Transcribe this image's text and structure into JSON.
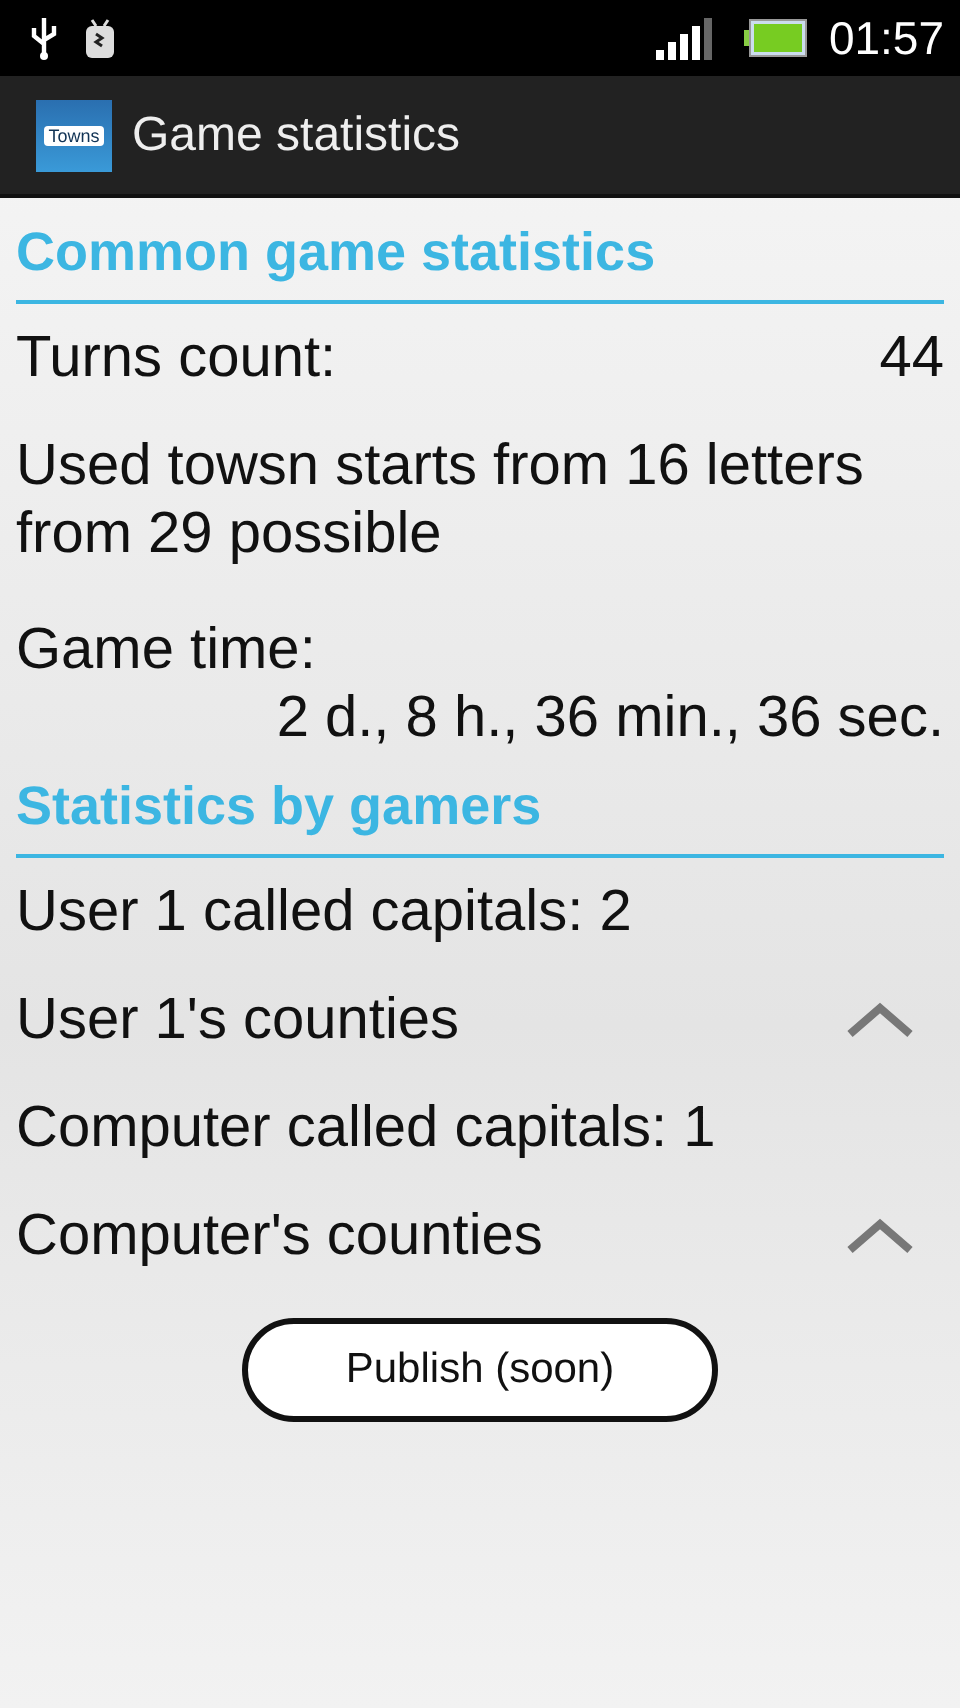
{
  "status_bar": {
    "time": "01:57"
  },
  "action_bar": {
    "logo_text": "Towns",
    "title": "Game statistics"
  },
  "sections": [
    {
      "title": "Common game statistics",
      "rows": [
        {
          "kind": "pair",
          "label": "Turns count:",
          "value": "44"
        },
        {
          "kind": "text",
          "text": "Used towsn starts from 16 letters from 29 possible"
        },
        {
          "kind": "stacked",
          "label": "Game time:",
          "value": "2 d., 8 h., 36 min., 36 sec."
        }
      ]
    },
    {
      "title": "Statistics by gamers",
      "rows": [
        {
          "kind": "text",
          "text": "User 1 called capitals: 2"
        },
        {
          "kind": "expander",
          "text": "User 1's counties"
        },
        {
          "kind": "text",
          "text": "Computer called capitals: 1"
        },
        {
          "kind": "expander",
          "text": "Computer's counties"
        }
      ]
    }
  ],
  "button": "Publish (soon)"
}
